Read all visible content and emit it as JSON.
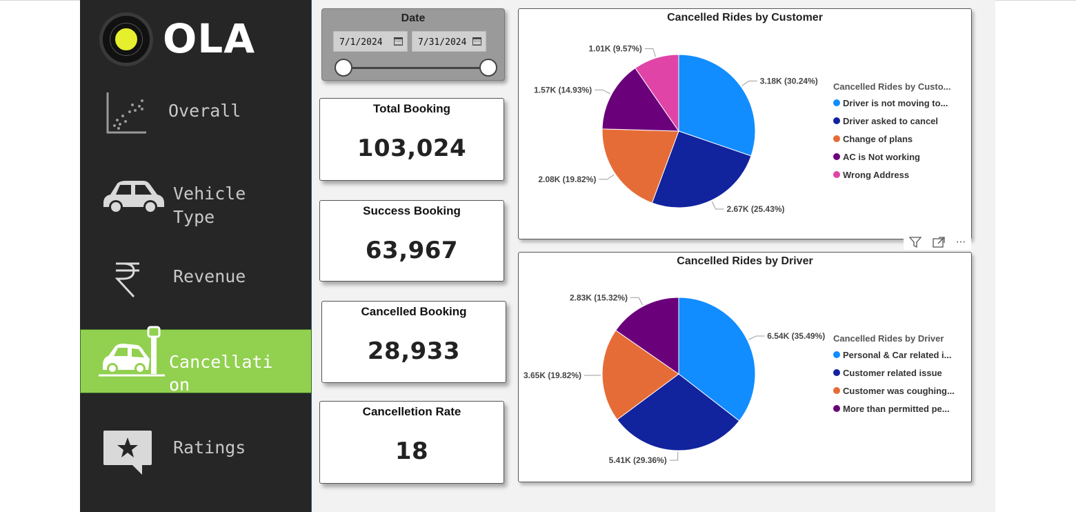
{
  "brand": {
    "logo_text": "OLA"
  },
  "nav": {
    "items": [
      {
        "id": "overall",
        "label_lines": [
          "Overall"
        ],
        "icon": "scatter-chart-icon",
        "active": false
      },
      {
        "id": "vehicle-type",
        "label_lines": [
          "Vehicle",
          "Type"
        ],
        "icon": "car-icon",
        "active": false
      },
      {
        "id": "revenue",
        "label_lines": [
          "Revenue"
        ],
        "icon": "rupee-icon",
        "active": false
      },
      {
        "id": "cancellation",
        "label_lines": [
          "Cancellati",
          "on"
        ],
        "icon": "car-crash-icon",
        "active": true
      },
      {
        "id": "ratings",
        "label_lines": [
          "Ratings"
        ],
        "icon": "star-review-icon",
        "active": false
      }
    ],
    "active_color": "#92d050"
  },
  "date_slicer": {
    "title": "Date",
    "start": "7/1/2024",
    "end": "7/31/2024"
  },
  "kpis": [
    {
      "title": "Total Booking",
      "value": "103,024"
    },
    {
      "title": "Success Booking",
      "value": "63,967"
    },
    {
      "title": "Cancelled Booking",
      "value": "28,933"
    },
    {
      "title": "Cancelletion Rate",
      "value": "18"
    }
  ],
  "visual_header": {
    "filter_icon": "filter-icon",
    "focus_icon": "focus-mode-icon",
    "more_icon": "more-options-icon"
  },
  "chart_data": [
    {
      "type": "pie",
      "title": "Cancelled Rides by Customer",
      "legend_title": "Cancelled Rides by Custo...",
      "legend_position": "right",
      "categories": [
        "Driver is not moving to...",
        "Driver asked to cancel",
        "Change of plans",
        "AC is Not working",
        "Wrong Address"
      ],
      "values": [
        3180,
        2670,
        2080,
        1570,
        1010
      ],
      "percent": [
        30.24,
        25.43,
        19.82,
        14.93,
        9.57
      ],
      "data_labels": [
        "3.18K (30.24%)",
        "2.67K (25.43%)",
        "2.08K (19.82%)",
        "1.57K (14.93%)",
        "1.01K (9.57%)"
      ],
      "colors": [
        "#118dff",
        "#12239e",
        "#e66c37",
        "#6b007b",
        "#e044a7"
      ]
    },
    {
      "type": "pie",
      "title": "Cancelled Rides by Driver",
      "legend_title": "Cancelled Rides by Driver",
      "legend_position": "right",
      "categories": [
        "Personal & Car related i...",
        "Customer related issue",
        "Customer was coughing...",
        "More than permitted pe..."
      ],
      "values": [
        6540,
        5410,
        3650,
        2830
      ],
      "percent": [
        35.49,
        29.36,
        19.82,
        15.32
      ],
      "data_labels": [
        "6.54K (35.49%)",
        "5.41K (29.36%)",
        "3.65K (19.82%)",
        "2.83K (15.32%)"
      ],
      "colors": [
        "#118dff",
        "#12239e",
        "#e66c37",
        "#6b007b"
      ]
    }
  ]
}
